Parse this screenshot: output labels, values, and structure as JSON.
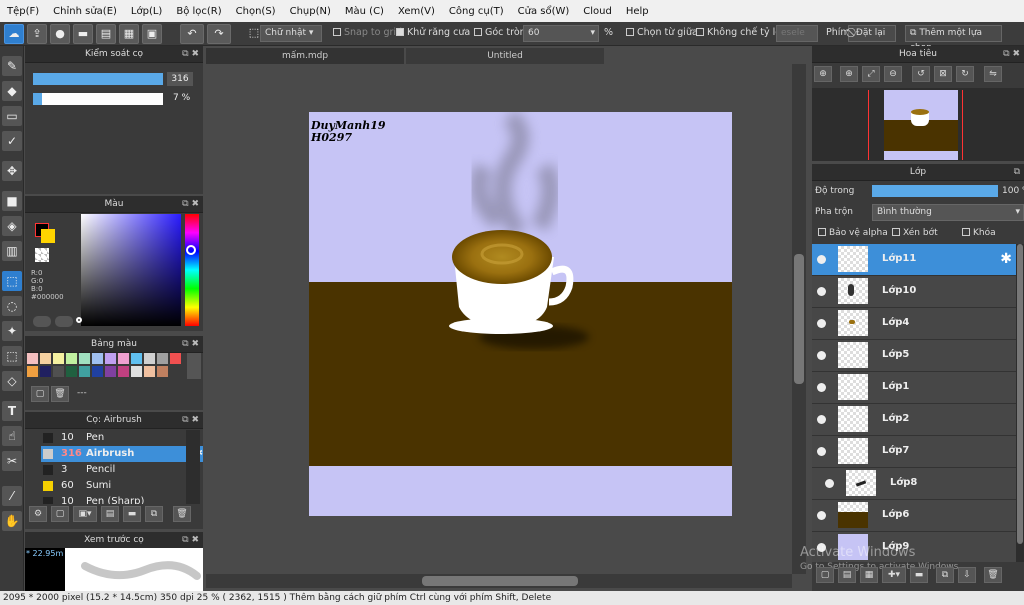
{
  "menu": [
    "Tệp(F)",
    "Chỉnh sửa(E)",
    "Lớp(L)",
    "Bộ lọc(R)",
    "Chọn(S)",
    "Chụp(N)",
    "Màu (C)",
    "Xem(V)",
    "Công cụ(T)",
    "Cửa sổ(W)",
    "Cloud",
    "Help"
  ],
  "toolbar": {
    "shape_select": "Chữ nhật",
    "snap_label": "Snap to grid",
    "antialias_label": "Khử răng cưa",
    "round_label": "Góc tròn",
    "round_value": "60",
    "percent": "%",
    "select_center_label": "Chọn từ giữa",
    "no_ratio_label": "Không chế tỷ lệ",
    "search_placeholder": "esele",
    "keys_label": "Phím",
    "reset_label": "Đặt lại",
    "add_selection_label": "Thêm một lựa chọn"
  },
  "brush_control": {
    "title": "Kiểm soát cọ",
    "size_value": "316",
    "opacity_value": "7 %",
    "size_fraction": 1.0,
    "opacity_fraction": 0.07
  },
  "color_panel": {
    "title": "Màu",
    "r": "R:0",
    "g": "G:0",
    "b": "B:0",
    "hex": "#000000",
    "fg_color": "#000000",
    "bg_color": "#ffd400"
  },
  "palette": {
    "title": "Bảng màu",
    "extra": "---",
    "colors": [
      "#f5c0c0",
      "#f5d0a0",
      "#f5f0a0",
      "#c0f0a0",
      "#a0e0c0",
      "#a0c0f0",
      "#c0a0f0",
      "#f0a0d0",
      "#60c0f0",
      "#d0d0d0",
      "#a0a0a0",
      "#f05050",
      "#f0a040",
      "#202060",
      "#505050",
      "#206040",
      "#40a0a0",
      "#2040a0",
      "#8040a0",
      "#c04080",
      "#e0e0e0",
      "#f0c0a0",
      "#c08060"
    ]
  },
  "brush_list": {
    "title": "Cọ: Airbrush",
    "items": [
      {
        "num": "10",
        "name": "Pen",
        "swatch": "#222222"
      },
      {
        "num": "316",
        "name": "Airbrush",
        "swatch": "#cccccc"
      },
      {
        "num": "3",
        "name": "Pencil",
        "swatch": "#222222"
      },
      {
        "num": "60",
        "name": "Sumi",
        "swatch": "#f5d000"
      },
      {
        "num": "10",
        "name": "Pen (Sharp)",
        "swatch": "#222222"
      }
    ]
  },
  "preview": {
    "title": "Xem trước cọ",
    "size_text": "* 22.95m"
  },
  "doc_tabs": [
    "mấm.mdp",
    "Untitled"
  ],
  "canvas": {
    "signature_line1": "DuyManh19",
    "signature_line2": "H0297",
    "bg_color": "#c6c4f5",
    "table_color": "#4a3300",
    "coffee_color": "#a47a10"
  },
  "navigator": {
    "title": "Hoa tiêu"
  },
  "layers": {
    "title": "Lớp",
    "opacity_label": "Độ trong",
    "opacity_value": "100 %",
    "blend_label": "Pha trộn",
    "blend_value": "Bình thường",
    "protect_alpha": "Bảo vệ alpha",
    "clipping": "Xén bớt",
    "lock": "Khóa",
    "items": [
      "Lớp11",
      "Lớp10",
      "Lớp4",
      "Lớp5",
      "Lớp1",
      "Lớp2",
      "Lớp7",
      "Lớp8",
      "Lớp6",
      "Lớp9"
    ]
  },
  "watermark": {
    "line1": "Activate Windows",
    "line2": "Go to Settings to activate Windows."
  },
  "status": "2095 * 2000 pixel  (15.2 * 14.5cm)  350 dpi  25 %  ( 2362, 1515 )  Thêm bằng cách giữ phím Ctrl cùng với phím Shift, Delete"
}
